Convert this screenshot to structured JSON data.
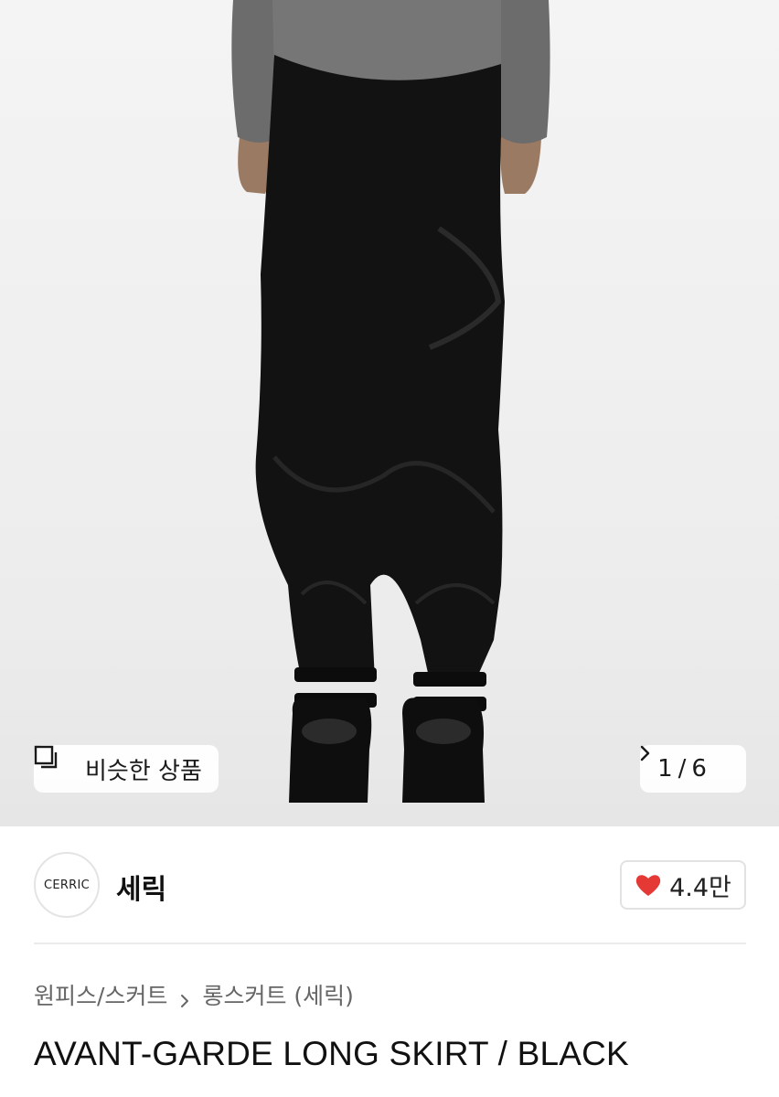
{
  "gallery": {
    "similar_label": "비슷한 상품",
    "similar_icon": "copy-square-icon",
    "pager_current": "1",
    "pager_separator": "/",
    "pager_total": "6",
    "pager_icon": "chevron-right-icon"
  },
  "brand": {
    "logo_text": "CERRIC",
    "name": "세릭",
    "like_icon": "heart-icon",
    "like_count": "4.4만",
    "like_color": "#e53935"
  },
  "breadcrumb": {
    "items": [
      "원피스/스커트",
      "롱스커트 (세릭)"
    ],
    "separator_icon": "chevron-right-icon"
  },
  "product": {
    "title": "AVANT-GARDE LONG SKIRT / BLACK"
  }
}
